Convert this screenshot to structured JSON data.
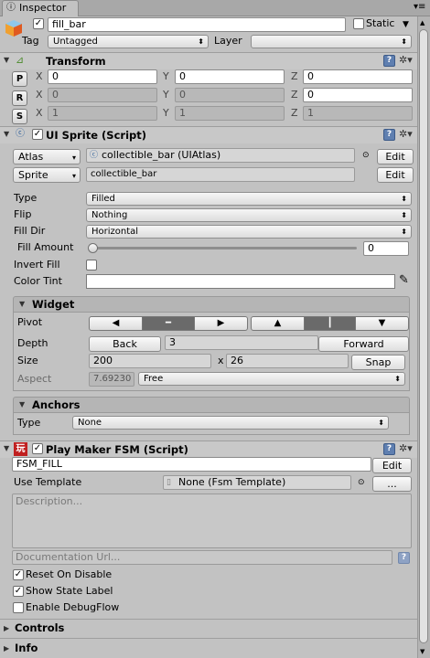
{
  "window": {
    "tab": "Inspector"
  },
  "object": {
    "name": "fill_bar",
    "static_label": "Static",
    "tag_label": "Tag",
    "tag_value": "Untagged",
    "layer_label": "Layer",
    "layer_value": ""
  },
  "transform": {
    "title": "Transform",
    "rows": [
      {
        "btn": "P",
        "x": "0",
        "y": "0",
        "z": "0"
      },
      {
        "btn": "R",
        "x": "0",
        "y": "0",
        "z": "0"
      },
      {
        "btn": "S",
        "x": "1",
        "y": "1",
        "z": "1"
      }
    ],
    "axis_x": "X",
    "axis_y": "Y",
    "axis_z": "Z"
  },
  "ui_sprite": {
    "title": "UI Sprite (Script)",
    "atlas_btn": "Atlas",
    "atlas_value": "collectible_bar (UIAtlas)",
    "edit1": "Edit",
    "sprite_btn": "Sprite",
    "sprite_value": "collectible_bar",
    "edit2": "Edit",
    "type_label": "Type",
    "type_value": "Filled",
    "flip_label": "Flip",
    "flip_value": "Nothing",
    "filldir_label": "Fill Dir",
    "filldir_value": "Horizontal",
    "fillamount_label": "Fill Amount",
    "fillamount_value": "0",
    "invert_label": "Invert Fill",
    "colortint_label": "Color Tint"
  },
  "widget": {
    "title": "Widget",
    "pivot_label": "Pivot",
    "pivot_h": [
      "◀",
      "━",
      "▶"
    ],
    "pivot_v": [
      "▲",
      "┃",
      "▼"
    ],
    "depth_label": "Depth",
    "back_btn": "Back",
    "depth_value": "3",
    "forward_btn": "Forward",
    "size_label": "Size",
    "size_w": "200",
    "size_x": "x",
    "size_h": "26",
    "snap_btn": "Snap",
    "aspect_label": "Aspect",
    "aspect_value": "7.69230",
    "aspect_mode": "Free"
  },
  "anchors": {
    "title": "Anchors",
    "type_label": "Type",
    "type_value": "None"
  },
  "playmaker": {
    "title": "Play Maker FSM (Script)",
    "fsm_name": "FSM_FILL",
    "edit_btn": "Edit",
    "template_label": "Use Template",
    "template_value": "None (Fsm Template)",
    "more_btn": "...",
    "description_placeholder": "Description...",
    "docurl_placeholder": "Documentation Url...",
    "reset_label": "Reset On Disable",
    "showstate_label": "Show State Label",
    "debugflow_label": "Enable DebugFlow",
    "reset_checked": true,
    "showstate_checked": true,
    "debugflow_checked": false
  },
  "sections": {
    "controls": "Controls",
    "info": "Info"
  },
  "icons": {
    "help": "?",
    "gear": "✲",
    "checkmark": "✓",
    "menu": "▾"
  },
  "colors": {
    "bg": "#c2c2c2",
    "header": "#c8c8c8",
    "selected_seg": "#6a6a6a"
  }
}
